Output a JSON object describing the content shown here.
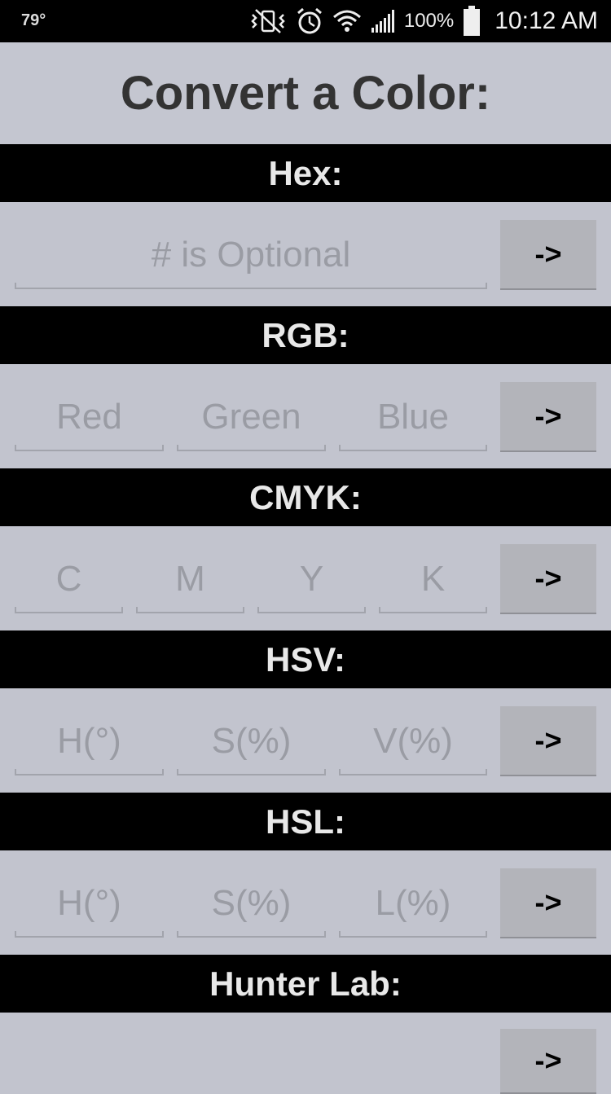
{
  "status_bar": {
    "temperature": "79°",
    "battery_percent": "100%",
    "time": "10:12 AM",
    "icons": [
      "vibrate-icon",
      "alarm-icon",
      "wifi-icon",
      "signal-icon",
      "battery-icon"
    ]
  },
  "title": "Convert a Color:",
  "sections": {
    "hex": {
      "header": "Hex:",
      "fields": [
        "# is Optional"
      ],
      "button": "->"
    },
    "rgb": {
      "header": "RGB:",
      "fields": [
        "Red",
        "Green",
        "Blue"
      ],
      "button": "->"
    },
    "cmyk": {
      "header": "CMYK:",
      "fields": [
        "C",
        "M",
        "Y",
        "K"
      ],
      "button": "->"
    },
    "hsv": {
      "header": "HSV:",
      "fields": [
        "H(°)",
        "S(%)",
        "V(%)"
      ],
      "button": "->"
    },
    "hsl": {
      "header": "HSL:",
      "fields": [
        "H(°)",
        "S(%)",
        "L(%)"
      ],
      "button": "->"
    },
    "hunter_lab": {
      "header": "Hunter Lab:",
      "button": "->"
    }
  },
  "colors": {
    "background": "#c2c4ce",
    "header_bar": "#000000",
    "button": "#b3b4ba",
    "placeholder_text": "#9a9ca4"
  }
}
